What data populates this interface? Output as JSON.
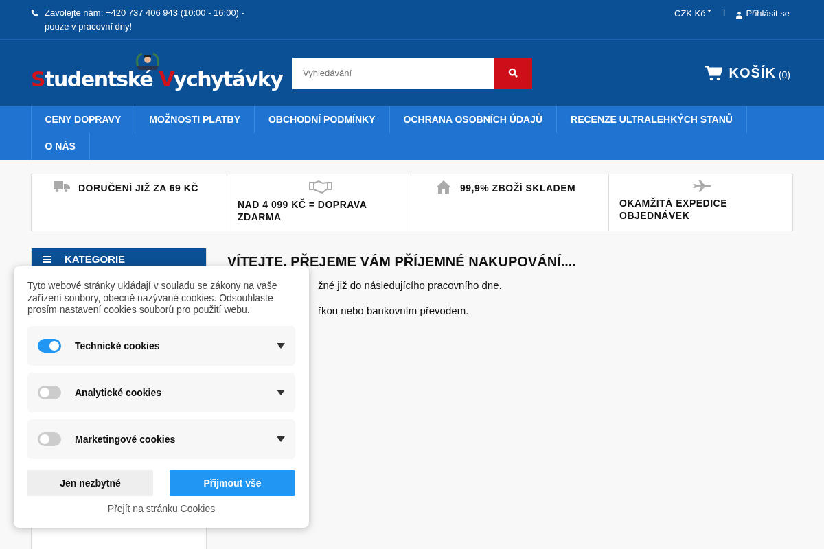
{
  "top_bar": {
    "phone": "Zavolejte nám: +420 737 406 943 (10:00 - 16:00) - pouze v pracovní dny!",
    "currency": "CZK Kč",
    "separator": "I",
    "login": "Přihlásit se"
  },
  "header": {
    "logo": {
      "first_initial": "S",
      "first_rest": "tudentské",
      "second_initial": "V",
      "second_rest": "ychytávky"
    },
    "search": {
      "placeholder": "Vyhledávání"
    },
    "cart": {
      "label": "KOŠÍK",
      "count": "(0)"
    }
  },
  "nav": {
    "items": [
      "CENY DOPRAVY",
      "MOŽNOSTI PLATBY",
      "OBCHODNÍ PODMÍNKY",
      "OCHRANA OSOBNÍCH ÚDAJŮ",
      "RECENZE ULTRALEHKÝCH STANŮ",
      "O NÁS"
    ]
  },
  "benefits": [
    {
      "kind": "truck",
      "text": "DORUČENÍ JIŽ ZA 69 KČ"
    },
    {
      "kind": "handshake",
      "text": "NAD 4 099 KČ = DOPRAVA ZDARMA"
    },
    {
      "kind": "house",
      "text": "99,9% ZBOŽÍ SKLADEM"
    },
    {
      "kind": "plane",
      "text": "OKAMŽITÁ EXPEDICE OBJEDNÁVEK"
    }
  ],
  "sidebar": {
    "title": "KATEGORIE"
  },
  "content": {
    "heading": "VÍTEJTE, PŘEJEME VÁM PŘÍJEMNÉ NAKUPOVÁNÍ....",
    "paragraphs": [
      "žné již do následujícího pracovního dne.",
      "řkou nebo bankovním převodem."
    ]
  },
  "cookie_dialog": {
    "text": "Tyto webové stránky ukládají v souladu se zákony na vaše zařízení soubory, obecně nazývané cookies. Odsouhlaste prosím nastavení cookies souborů pro použití webu.",
    "options": [
      {
        "label": "Technické cookies",
        "on": true
      },
      {
        "label": "Analytické cookies",
        "on": false
      },
      {
        "label": "Marketingové cookies",
        "on": false
      }
    ],
    "buttons": [
      {
        "label": "Jen nezbytné",
        "kind": "secondary"
      },
      {
        "label": "Přijmout vše",
        "kind": "primary"
      }
    ],
    "link": "Přejít na stránku Cookies"
  }
}
